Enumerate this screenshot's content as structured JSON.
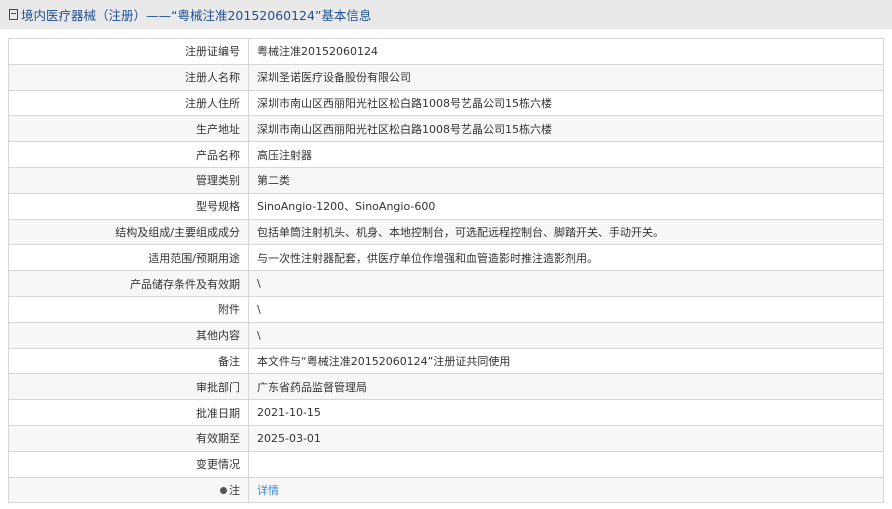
{
  "header": {
    "title": "境内医疗器械（注册）——“粤械注准20152060124”基本信息"
  },
  "rows": [
    {
      "label": "注册证编号",
      "value": "粤械注准20152060124"
    },
    {
      "label": "注册人名称",
      "value": "深圳圣诺医疗设备股份有限公司"
    },
    {
      "label": "注册人住所",
      "value": "深圳市南山区西丽阳光社区松白路1008号艺晶公司15栋六楼"
    },
    {
      "label": "生产地址",
      "value": "深圳市南山区西丽阳光社区松白路1008号艺晶公司15栋六楼"
    },
    {
      "label": "产品名称",
      "value": "高压注射器"
    },
    {
      "label": "管理类别",
      "value": "第二类"
    },
    {
      "label": "型号规格",
      "value": "SinoAngio-1200、SinoAngio-600"
    },
    {
      "label": "结构及组成/主要组成成分",
      "value": "包括单筒注射机头、机身、本地控制台，可选配远程控制台、脚踏开关、手动开关。"
    },
    {
      "label": "适用范围/预期用途",
      "value": "与一次性注射器配套，供医疗单位作增强和血管造影时推注造影剂用。"
    },
    {
      "label": "产品储存条件及有效期",
      "value": "\\"
    },
    {
      "label": "附件",
      "value": "\\"
    },
    {
      "label": "其他内容",
      "value": "\\"
    },
    {
      "label": "备注",
      "value": "本文件与“粤械注准20152060124”注册证共同使用"
    },
    {
      "label": "审批部门",
      "value": "广东省药品监督管理局"
    },
    {
      "label": "批准日期",
      "value": "2021-10-15"
    },
    {
      "label": "有效期至",
      "value": "2025-03-01"
    },
    {
      "label": "变更情况",
      "value": ""
    }
  ],
  "note": {
    "label": "注",
    "link": "详情"
  }
}
